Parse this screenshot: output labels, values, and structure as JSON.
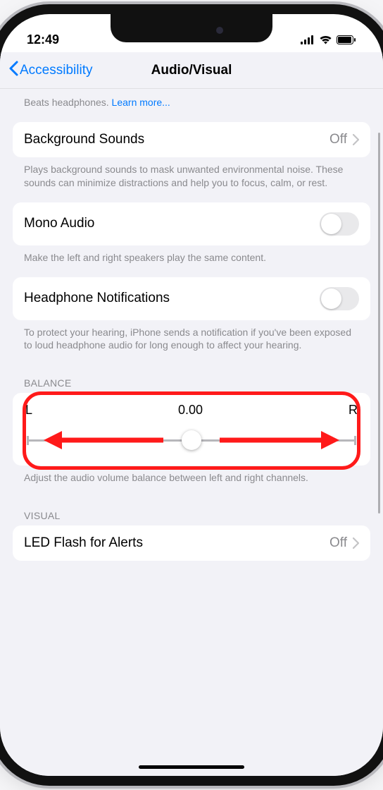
{
  "status": {
    "time": "12:49"
  },
  "nav": {
    "back": "Accessibility",
    "title": "Audio/Visual"
  },
  "truncated": {
    "prefix": "Beats headphones. ",
    "link": "Learn more..."
  },
  "bg_sounds": {
    "label": "Background Sounds",
    "value": "Off",
    "footer": "Plays background sounds to mask unwanted environmental noise. These sounds can minimize distractions and help you to focus, calm, or rest."
  },
  "mono": {
    "label": "Mono Audio",
    "footer": "Make the left and right speakers play the same content."
  },
  "headphone": {
    "label": "Headphone Notifications",
    "footer": "To protect your hearing, iPhone sends a notification if you've been exposed to loud headphone audio for long enough to affect your hearing."
  },
  "balance": {
    "header": "BALANCE",
    "left": "L",
    "value": "0.00",
    "right": "R",
    "footer": "Adjust the audio volume balance between left and right channels."
  },
  "visual": {
    "header": "VISUAL"
  },
  "led": {
    "label": "LED Flash for Alerts",
    "value": "Off"
  }
}
